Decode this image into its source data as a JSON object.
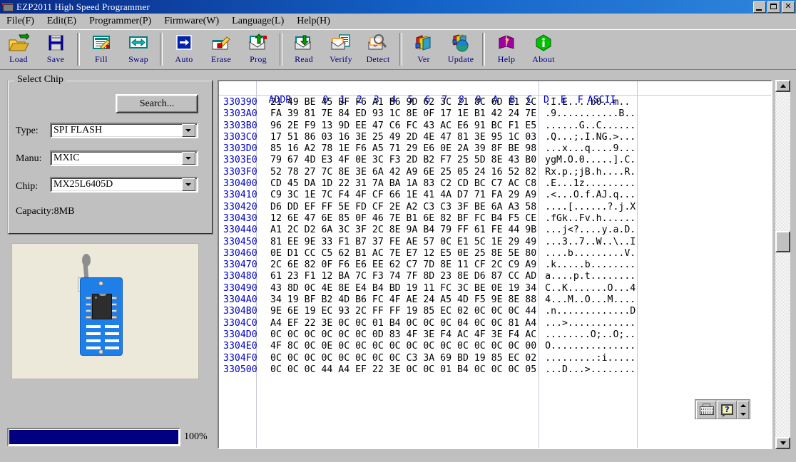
{
  "window": {
    "title": "EZP2011 High Speed Programmer",
    "icon": "chip-icon",
    "minimize_label": "",
    "maximize_label": "",
    "close_label": "✕"
  },
  "menu": [
    {
      "name": "file",
      "label": "File(F)"
    },
    {
      "name": "edit",
      "label": "Edit(E)"
    },
    {
      "name": "programmer",
      "label": "Programmer(P)"
    },
    {
      "name": "firmware",
      "label": "Firmware(W)"
    },
    {
      "name": "language",
      "label": "Language(L)"
    },
    {
      "name": "help",
      "label": "Help(H)"
    }
  ],
  "toolbar": [
    {
      "name": "load",
      "label": "Load",
      "icon": "open-folder-icon"
    },
    {
      "name": "save",
      "label": "Save",
      "icon": "floppy-disk-icon"
    },
    {
      "name": "fill",
      "label": "Fill",
      "icon": "fill-pencil-icon"
    },
    {
      "name": "swap",
      "label": "Swap",
      "icon": "left-right-arrow-icon"
    },
    {
      "name": "auto",
      "label": "Auto",
      "icon": "right-arrow-box-icon"
    },
    {
      "name": "erase",
      "label": "Erase",
      "icon": "erase-brush-icon"
    },
    {
      "name": "prog",
      "label": "Prog",
      "icon": "program-arrow-icon"
    },
    {
      "name": "read",
      "label": "Read",
      "icon": "read-arrow-icon"
    },
    {
      "name": "verify",
      "label": "Verify",
      "icon": "verify-doc-icon"
    },
    {
      "name": "detect",
      "label": "Detect",
      "icon": "magnifier-icon"
    },
    {
      "name": "ver",
      "label": "Ver",
      "icon": "version-books-icon"
    },
    {
      "name": "update",
      "label": "Update",
      "icon": "globe-update-icon"
    },
    {
      "name": "help",
      "label": "Help",
      "icon": "help-book-icon"
    },
    {
      "name": "about",
      "label": "About",
      "icon": "info-icon"
    }
  ],
  "toolbar_separators_after": [
    "save",
    "swap",
    "prog",
    "detect",
    "update"
  ],
  "select_chip": {
    "legend": "Select Chip",
    "search_label": "Search...",
    "type_label": "Type:",
    "type_value": "SPI FLASH",
    "manu_label": "Manu:",
    "manu_value": "MXIC",
    "chip_label": "Chip:",
    "chip_value": "MX25L6405D",
    "capacity": "Capacity:8MB"
  },
  "progress": {
    "value": 100,
    "text": "100%"
  },
  "hex": {
    "header": {
      "addr": "ADDR",
      "columns": [
        "0",
        "1",
        "2",
        "3",
        "4",
        "5",
        "6",
        "7",
        "8",
        "9",
        "A",
        "B",
        "C",
        "D",
        "E",
        "F"
      ],
      "ascii": "ASCII"
    },
    "rows": [
      {
        "addr": "330390",
        "bytes": [
          "21",
          "49",
          "BE",
          "45",
          "BF",
          "F6",
          "A1",
          "B6",
          "9D",
          "62",
          "3C",
          "21",
          "8C",
          "6D",
          "E1",
          "2C"
        ],
        "ascii": ".I.E....b0..m.."
      },
      {
        "addr": "3303A0",
        "bytes": [
          "FA",
          "39",
          "81",
          "7E",
          "84",
          "ED",
          "93",
          "1C",
          "8E",
          "0F",
          "17",
          "1E",
          "B1",
          "42",
          "24",
          "7E"
        ],
        "ascii": ".9...........B.."
      },
      {
        "addr": "3303B0",
        "bytes": [
          "96",
          "2E",
          "F9",
          "13",
          "9D",
          "EE",
          "47",
          "C6",
          "FC",
          "43",
          "AC",
          "E6",
          "91",
          "BC",
          "F1",
          "E5"
        ],
        "ascii": "......G..C......"
      },
      {
        "addr": "3303C0",
        "bytes": [
          "17",
          "51",
          "86",
          "03",
          "16",
          "3E",
          "25",
          "49",
          "2D",
          "4E",
          "47",
          "81",
          "3E",
          "95",
          "1C",
          "03"
        ],
        "ascii": ".Q...;.I.NG.>..."
      },
      {
        "addr": "3303D0",
        "bytes": [
          "85",
          "16",
          "A2",
          "78",
          "1E",
          "F6",
          "A5",
          "71",
          "29",
          "E6",
          "0E",
          "2A",
          "39",
          "8F",
          "BE",
          "98"
        ],
        "ascii": "...x...q....9..."
      },
      {
        "addr": "3303E0",
        "bytes": [
          "79",
          "67",
          "4D",
          "E3",
          "4F",
          "0E",
          "3C",
          "F3",
          "2D",
          "B2",
          "F7",
          "25",
          "5D",
          "8E",
          "43",
          "B0"
        ],
        "ascii": "ygM.O.0.....].C."
      },
      {
        "addr": "3303F0",
        "bytes": [
          "52",
          "78",
          "27",
          "7C",
          "8E",
          "3E",
          "6A",
          "42",
          "A9",
          "6E",
          "25",
          "05",
          "24",
          "16",
          "52",
          "82"
        ],
        "ascii": "Rx.p.;jB.h....R."
      },
      {
        "addr": "330400",
        "bytes": [
          "CD",
          "45",
          "DA",
          "1D",
          "22",
          "31",
          "7A",
          "BA",
          "1A",
          "83",
          "C2",
          "CD",
          "BC",
          "C7",
          "AC",
          "C8"
        ],
        "ascii": ".E...1z........."
      },
      {
        "addr": "330410",
        "bytes": [
          "C9",
          "3C",
          "1E",
          "7C",
          "F4",
          "4F",
          "CF",
          "66",
          "1E",
          "41",
          "4A",
          "D7",
          "71",
          "FA",
          "29",
          "A9"
        ],
        "ascii": ".<...O.f.AJ.q..."
      },
      {
        "addr": "330420",
        "bytes": [
          "D6",
          "DD",
          "EF",
          "FF",
          "5E",
          "FD",
          "CF",
          "2E",
          "A2",
          "C3",
          "C3",
          "3F",
          "BE",
          "6A",
          "A3",
          "58"
        ],
        "ascii": "....[......?.j.X"
      },
      {
        "addr": "330430",
        "bytes": [
          "12",
          "6E",
          "47",
          "6E",
          "85",
          "0F",
          "46",
          "7E",
          "B1",
          "6E",
          "82",
          "BF",
          "FC",
          "B4",
          "F5",
          "CE"
        ],
        "ascii": ".fGk..Fv.h......"
      },
      {
        "addr": "330440",
        "bytes": [
          "A1",
          "2C",
          "D2",
          "6A",
          "3C",
          "3F",
          "2C",
          "8E",
          "9A",
          "B4",
          "79",
          "FF",
          "61",
          "FE",
          "44",
          "9B"
        ],
        "ascii": "...j<?....y.a.D."
      },
      {
        "addr": "330450",
        "bytes": [
          "81",
          "EE",
          "9E",
          "33",
          "F1",
          "B7",
          "37",
          "FE",
          "AE",
          "57",
          "0C",
          "E1",
          "5C",
          "1E",
          "29",
          "49"
        ],
        "ascii": "...3..7..W..\\..I"
      },
      {
        "addr": "330460",
        "bytes": [
          "0E",
          "D1",
          "CC",
          "C5",
          "62",
          "B1",
          "AC",
          "7E",
          "E7",
          "12",
          "E5",
          "0E",
          "25",
          "8E",
          "5E",
          "80"
        ],
        "ascii": "....b.........V."
      },
      {
        "addr": "330470",
        "bytes": [
          "2C",
          "6E",
          "82",
          "0F",
          "F6",
          "E6",
          "EE",
          "62",
          "C7",
          "7D",
          "8E",
          "11",
          "CF",
          "2C",
          "C9",
          "A9"
        ],
        "ascii": ".k.....b........"
      },
      {
        "addr": "330480",
        "bytes": [
          "61",
          "23",
          "F1",
          "12",
          "BA",
          "7C",
          "F3",
          "74",
          "7F",
          "8D",
          "23",
          "8E",
          "D6",
          "87",
          "CC",
          "AD"
        ],
        "ascii": "a....p.t........"
      },
      {
        "addr": "330490",
        "bytes": [
          "43",
          "8D",
          "0C",
          "4E",
          "8E",
          "E4",
          "B4",
          "BD",
          "19",
          "11",
          "FC",
          "3C",
          "BE",
          "0E",
          "19",
          "34"
        ],
        "ascii": "C..K.......O...4"
      },
      {
        "addr": "3304A0",
        "bytes": [
          "34",
          "19",
          "BF",
          "B2",
          "4D",
          "B6",
          "FC",
          "4F",
          "AE",
          "24",
          "A5",
          "4D",
          "F5",
          "9E",
          "8E",
          "88"
        ],
        "ascii": "4...M..O...M...."
      },
      {
        "addr": "3304B0",
        "bytes": [
          "9E",
          "6E",
          "19",
          "EC",
          "93",
          "2C",
          "FF",
          "FF",
          "19",
          "85",
          "EC",
          "02",
          "0C",
          "0C",
          "0C",
          "44"
        ],
        "ascii": ".n.............D"
      },
      {
        "addr": "3304C0",
        "bytes": [
          "A4",
          "EF",
          "22",
          "3E",
          "0C",
          "0C",
          "01",
          "B4",
          "0C",
          "0C",
          "0C",
          "04",
          "0C",
          "0C",
          "81",
          "A4"
        ],
        "ascii": "...>............"
      },
      {
        "addr": "3304D0",
        "bytes": [
          "0C",
          "0C",
          "0C",
          "0C",
          "0C",
          "0C",
          "0D",
          "83",
          "4F",
          "3E",
          "F4",
          "AC",
          "4F",
          "3E",
          "F4",
          "AC"
        ],
        "ascii": "........O;..O;.."
      },
      {
        "addr": "3304E0",
        "bytes": [
          "4F",
          "8C",
          "0C",
          "0E",
          "0C",
          "0C",
          "0C",
          "0C",
          "0C",
          "0C",
          "0C",
          "0C",
          "0C",
          "0C",
          "0C",
          "00"
        ],
        "ascii": "O..............."
      },
      {
        "addr": "3304F0",
        "bytes": [
          "0C",
          "0C",
          "0C",
          "0C",
          "0C",
          "0C",
          "0C",
          "0C",
          "C3",
          "3A",
          "69",
          "BD",
          "19",
          "85",
          "EC",
          "02"
        ],
        "ascii": ".........:i....."
      },
      {
        "addr": "330500",
        "bytes": [
          "0C",
          "0C",
          "0C",
          "44",
          "A4",
          "EF",
          "22",
          "3E",
          "0C",
          "0C",
          "01",
          "B4",
          "0C",
          "0C",
          "0C",
          "05"
        ],
        "ascii": "...D...>........"
      }
    ]
  },
  "hex_buttons": [
    {
      "name": "keyboard-input-button",
      "icon": "keyboard-icon"
    },
    {
      "name": "hex-help-button",
      "icon": "help-balloon-icon"
    },
    {
      "name": "hex-spinner",
      "icon": "spinner-icon"
    }
  ],
  "scrollbar": {
    "up_icon": "triangle-up-icon",
    "down_icon": "triangle-down-icon",
    "thumb_position_percent": 43
  },
  "colors": {
    "title_start": "#0a2a87",
    "title_end": "#2f86dd",
    "face": "#c0c0c0",
    "hex_addr": "#0000c8",
    "hex_byte": "#000000",
    "label_blue": "#000080",
    "progress_fill": "#000080",
    "socket_bg": "#ece9db",
    "socket_blue": "#1f7fe8"
  }
}
